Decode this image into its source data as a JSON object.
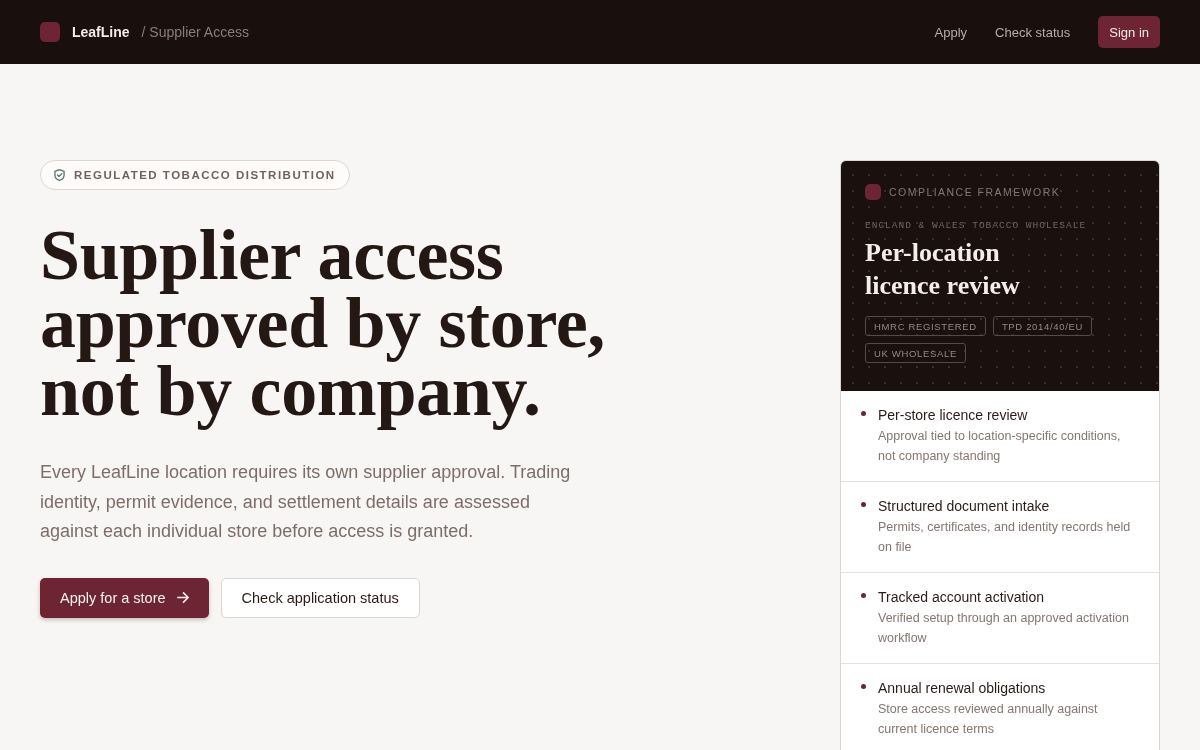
{
  "header": {
    "brand": "LeafLine",
    "breadcrumb": "/ Supplier Access",
    "nav": [
      "Apply",
      "Check status"
    ],
    "sign_in": "Sign in"
  },
  "hero": {
    "badge": "REGULATED TOBACCO DISTRIBUTION",
    "heading": "Supplier access approved by store, not by company.",
    "description": "Every LeafLine location requires its own supplier approval. Trading identity, permit evidence, and settlement details are assessed against each individual store before access is granted.",
    "buttons": [
      {
        "label": "Apply for a store",
        "kind": "primary"
      },
      {
        "label": "Check application status",
        "kind": "secondary"
      }
    ]
  },
  "card": {
    "eyebrow": "COMPLIANCE FRAMEWORK",
    "kicker": "ENGLAND & WALES TOBACCO WHOLESALE",
    "title": "Per-location licence review",
    "tags": [
      "HMRC REGISTERED",
      "TPD 2014/40/EU",
      "UK WHOLESALE"
    ],
    "items": [
      {
        "title": "Per-store licence review",
        "description": "Approval tied to location-specific conditions, not company standing"
      },
      {
        "title": "Structured document intake",
        "description": "Permits, certificates, and identity records held on file"
      },
      {
        "title": "Tracked account activation",
        "description": "Verified setup through an approved activation workflow"
      },
      {
        "title": "Annual renewal obligations",
        "description": "Store access reviewed annually against current licence terms"
      }
    ]
  }
}
